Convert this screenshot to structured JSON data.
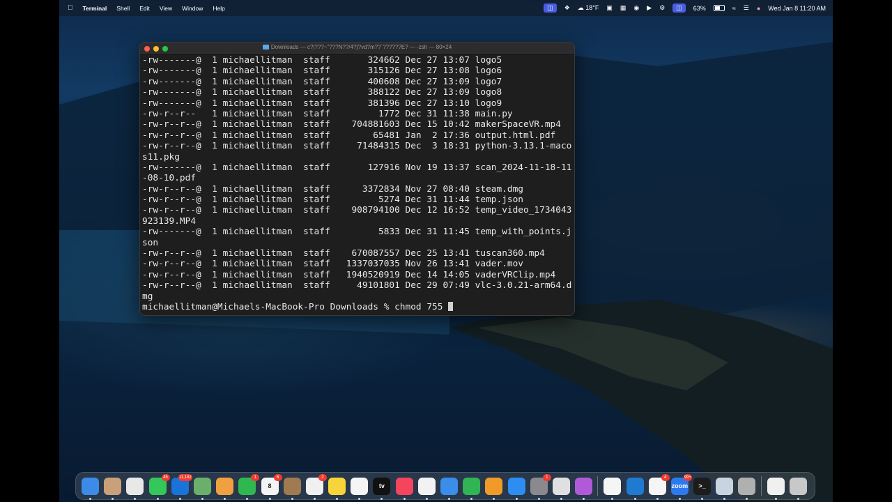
{
  "menubar": {
    "app_name": "Terminal",
    "menus": [
      "Shell",
      "Edit",
      "View",
      "Window",
      "Help"
    ],
    "status": {
      "weather": "18°F",
      "battery": "63%",
      "battery_level": 0.63,
      "datetime": "Wed Jan 8  11:20 AM"
    },
    "icons": [
      "screen-mirroring-icon",
      "dropbox-icon",
      "weather-icon",
      "app-icon",
      "calendar-icon",
      "app-icon",
      "play-icon",
      "settings-icon",
      "stage-manager-icon",
      "battery-icon",
      "wifi-icon",
      "control-center-icon",
      "user-icon"
    ]
  },
  "terminal": {
    "title": "Downloads — c?|???~\"???N??/4?]?vd?m??`??????E? — -zsh — 80×24",
    "lines": [
      "-rw-------@  1 michaellitman  staff       324662 Dec 27 13:07 logo5",
      "-rw-------@  1 michaellitman  staff       315126 Dec 27 13:08 logo6",
      "-rw-------@  1 michaellitman  staff       400608 Dec 27 13:09 logo7",
      "-rw-------@  1 michaellitman  staff       388122 Dec 27 13:09 logo8",
      "-rw-------@  1 michaellitman  staff       381396 Dec 27 13:10 logo9",
      "-rw-r--r--   1 michaellitman  staff         1772 Dec 31 11:38 main.py",
      "-rw-r--r--@  1 michaellitman  staff    704881603 Dec 15 10:42 makerSpaceVR.mp4",
      "-rw-r--r--@  1 michaellitman  staff        65481 Jan  2 17:36 output.html.pdf",
      "-rw-r--r--@  1 michaellitman  staff     71484315 Dec  3 18:31 python-3.13.1-maco",
      "s11.pkg",
      "-rw-------@  1 michaellitman  staff       127916 Nov 19 13:37 scan_2024-11-18-11",
      "-08-10.pdf",
      "-rw-r--r--@  1 michaellitman  staff      3372834 Nov 27 08:40 steam.dmg",
      "-rw-r--r--@  1 michaellitman  staff         5274 Dec 31 11:44 temp.json",
      "-rw-r--r--@  1 michaellitman  staff    908794100 Dec 12 16:52 temp_video_1734043",
      "923139.MP4",
      "-rw-------@  1 michaellitman  staff         5833 Dec 31 11:45 temp_with_points.j",
      "son",
      "-rw-r--r--@  1 michaellitman  staff    670087557 Dec 25 13:41 tuscan360.mp4",
      "-rw-r--r--@  1 michaellitman  staff   1337037035 Nov 26 13:41 vader.mov",
      "-rw-r--r--@  1 michaellitman  staff   1940520919 Dec 14 14:05 vaderVRClip.mp4",
      "-rw-r--r--@  1 michaellitman  staff     49101801 Dec 29 07:49 vlc-3.0.21-arm64.d",
      "mg"
    ],
    "prompt": "michaellitman@Michaels-MacBook-Pro Downloads % chmod 755 "
  },
  "dock": {
    "apps": [
      {
        "name": "finder-icon",
        "color": "#3d8be8",
        "badge": "",
        "label": ""
      },
      {
        "name": "launchpad-icon",
        "color": "#c9a07a",
        "badge": "",
        "label": ""
      },
      {
        "name": "chrome-icon",
        "color": "#e8e8e8",
        "badge": "",
        "label": ""
      },
      {
        "name": "messages-icon",
        "color": "#34c759",
        "badge": "45",
        "label": ""
      },
      {
        "name": "outlook-icon",
        "color": "#1a73d8",
        "badge": "11,162",
        "label": ""
      },
      {
        "name": "maps-icon",
        "color": "#6ab06a",
        "badge": "",
        "label": ""
      },
      {
        "name": "photos-icon",
        "color": "#f0a040",
        "badge": "",
        "label": ""
      },
      {
        "name": "facetime-icon",
        "color": "#2fb84f",
        "badge": "1",
        "label": ""
      },
      {
        "name": "calendar-icon",
        "color": "#f4f4f4",
        "badge": "6",
        "label": "8"
      },
      {
        "name": "notes-app-icon",
        "color": "#a07a50",
        "badge": "",
        "label": ""
      },
      {
        "name": "reminders-icon",
        "color": "#f0f0f0",
        "badge": "2",
        "label": ""
      },
      {
        "name": "notes-icon",
        "color": "#f7d53a",
        "badge": "",
        "label": ""
      },
      {
        "name": "freeform-icon",
        "color": "#f5f5f5",
        "badge": "",
        "label": ""
      },
      {
        "name": "apple-tv-icon",
        "color": "#111111",
        "badge": "",
        "label": "tv"
      },
      {
        "name": "music-icon",
        "color": "#f5455c",
        "badge": "",
        "label": ""
      },
      {
        "name": "news-icon",
        "color": "#f2f2f2",
        "badge": "",
        "label": ""
      },
      {
        "name": "keynote-icon",
        "color": "#3a8de8",
        "badge": "",
        "label": ""
      },
      {
        "name": "numbers-icon",
        "color": "#30b454",
        "badge": "",
        "label": ""
      },
      {
        "name": "pages-icon",
        "color": "#f09a2a",
        "badge": "",
        "label": ""
      },
      {
        "name": "app-store-icon",
        "color": "#2e8df0",
        "badge": "",
        "label": ""
      },
      {
        "name": "system-settings-icon",
        "color": "#8a8a8e",
        "badge": "1",
        "label": ""
      },
      {
        "name": "iphone-mirroring-icon",
        "color": "#e0e0e0",
        "badge": "",
        "label": ""
      },
      {
        "name": "feedback-icon",
        "color": "#b05ad8",
        "badge": "",
        "label": ""
      },
      {
        "sep": true
      },
      {
        "name": "chatgpt-icon",
        "color": "#f5f5f5",
        "badge": "",
        "label": ""
      },
      {
        "name": "vscode-icon",
        "color": "#1f7ad0",
        "badge": "",
        "label": ""
      },
      {
        "name": "slack-icon",
        "color": "#f5f5f5",
        "badge": "4",
        "label": ""
      },
      {
        "name": "zoom-icon",
        "color": "#2d7af0",
        "badge": "99+",
        "label": "zoom"
      },
      {
        "name": "terminal-icon",
        "color": "#1c1c1c",
        "badge": "",
        "label": ">_"
      },
      {
        "name": "preview-icon",
        "color": "#c8d4e0",
        "badge": "",
        "label": ""
      },
      {
        "name": "calculator-icon",
        "color": "#b0b0b0",
        "badge": "",
        "label": ""
      },
      {
        "sep": true
      },
      {
        "name": "document-icon",
        "color": "#f0f0f0",
        "badge": "",
        "label": ""
      },
      {
        "name": "trash-icon",
        "color": "#c8c8c8",
        "badge": "",
        "label": ""
      }
    ]
  }
}
